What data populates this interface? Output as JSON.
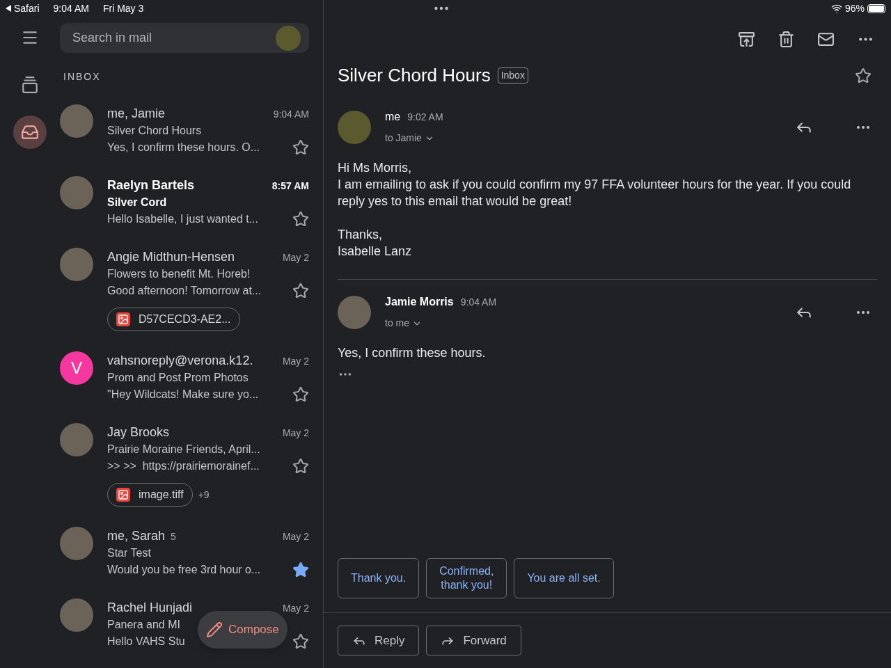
{
  "status_bar": {
    "back_app": "Safari",
    "time": "9:04 AM",
    "date": "Fri May 3",
    "battery": "96%"
  },
  "search": {
    "placeholder": "Search in mail"
  },
  "folder_label": "INBOX",
  "rail": [
    {
      "kind": "menu",
      "selected": false
    },
    {
      "kind": "stack",
      "selected": false
    },
    {
      "kind": "inbox",
      "selected": true
    }
  ],
  "emails": [
    {
      "sender": "me, Jamie",
      "time": "9:04 AM",
      "subject": "Silver Chord Hours",
      "snippet": "Yes, I confirm these hours. O...",
      "unread": false,
      "starred": false,
      "avatar": {
        "kind": "photo"
      }
    },
    {
      "sender": "Raelyn Bartels",
      "time": "8:57 AM",
      "subject": "Silver Cord",
      "snippet": "Hello Isabelle, I just wanted t...",
      "unread": true,
      "starred": false,
      "avatar": {
        "kind": "photo"
      }
    },
    {
      "sender": "Angie Midthun-Hensen",
      "time": "May 2",
      "subject": "Flowers to benefit Mt. Horeb!",
      "snippet": "Good afternoon! Tomorrow at...",
      "unread": false,
      "starred": false,
      "avatar": {
        "kind": "photo"
      },
      "attachment": {
        "name": "D57CECD3-AE2..."
      }
    },
    {
      "sender": "vahsnoreply@verona.k12.",
      "time": "May 2",
      "subject": "Prom and Post Prom Photos",
      "snippet": "\"Hey Wildcats! Make sure yo...",
      "unread": false,
      "starred": false,
      "avatar": {
        "kind": "letter",
        "letter": "V",
        "color": "#f538a0"
      }
    },
    {
      "sender": "Jay Brooks",
      "time": "May 2",
      "subject": "Prairie Moraine Friends, April...",
      "snippet": ">> >>  https://prairiemorainef...",
      "unread": false,
      "starred": false,
      "avatar": {
        "kind": "photo"
      },
      "attachment": {
        "name": "image.tiff",
        "more": "+9"
      }
    },
    {
      "sender": "me, Sarah",
      "count": "5",
      "time": "May 2",
      "subject": "Star Test",
      "snippet": "Would you be free 3rd hour o...",
      "unread": false,
      "starred": true,
      "avatar": {
        "kind": "photo"
      }
    },
    {
      "sender": "Rachel Hunjadi",
      "time": "May 2",
      "subject": "Panera and MI",
      "snippet": "Hello VAHS Stu",
      "unread": false,
      "starred": false,
      "avatar": {
        "kind": "photo"
      }
    }
  ],
  "compose": {
    "label": "Compose"
  },
  "thread": {
    "title": "Silver Chord Hours",
    "label": "Inbox",
    "starred": false,
    "messages": [
      {
        "sender": "me",
        "time": "9:02 AM",
        "to": "to Jamie",
        "bold": false,
        "avatar": {
          "kind": "illustration"
        },
        "paragraphs": [
          "Hi Ms Morris,\nI am emailing to ask if you could confirm my 97 FFA volunteer hours for the year. If you could reply yes to this email that would be great!",
          "Thanks,\nIsabelle Lanz"
        ]
      },
      {
        "sender": "Jamie Morris",
        "time": "9:04 AM",
        "to": "to me",
        "bold": true,
        "avatar": {
          "kind": "photo"
        },
        "paragraphs": [
          "Yes, I confirm these hours."
        ]
      }
    ],
    "smart_replies": [
      "Thank you.",
      "Confirmed,\nthank you!",
      "You are all set."
    ],
    "actions": [
      {
        "kind": "reply",
        "label": "Reply"
      },
      {
        "kind": "forward",
        "label": "Forward"
      }
    ]
  }
}
